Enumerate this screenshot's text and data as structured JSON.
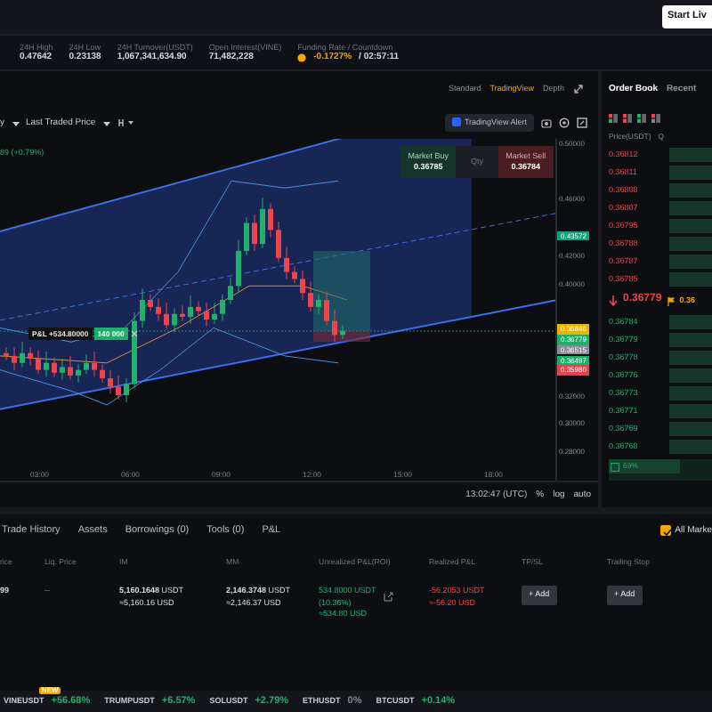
{
  "header": {
    "start_button": "Start Liv"
  },
  "stats": [
    {
      "label": "24H High",
      "value": "0.47642"
    },
    {
      "label": "24H Low",
      "value": "0.23138"
    },
    {
      "label": "24H Turnover(USDT)",
      "value": "1,067,341,634.90"
    },
    {
      "label": "Open Interest(VINE)",
      "value": "71,482,228"
    },
    {
      "label": "Funding Rate / Countdown",
      "kind": "funding",
      "value": "-0.1727%",
      "extra": "/ 02:57:11"
    }
  ],
  "chart_tabs": [
    {
      "label": "Standard",
      "selected": false
    },
    {
      "label": "TradingView",
      "selected": true
    },
    {
      "label": "Depth",
      "selected": false
    }
  ],
  "toolbar": {
    "interval": "y",
    "price_source": "Last Traded Price",
    "alert_button": "TradingView Alert"
  },
  "legend": "89 (+0.79%)",
  "quick_trade": {
    "buy_label": "Market Buy",
    "buy_price": "0.36785",
    "qty": "Qty",
    "sell_label": "Market Sell",
    "sell_price": "0.36784"
  },
  "position_tag": {
    "pnl": "P&L +534.80000",
    "qty": "140 000"
  },
  "price_axis": [
    {
      "text": "0.50000",
      "kind": "tick"
    },
    {
      "text": "0.46000",
      "kind": "tick"
    },
    {
      "text": "0.43572",
      "kind": "tag",
      "color": "#16a07a"
    },
    {
      "text": "0.42000",
      "kind": "tick"
    },
    {
      "text": "0.40000",
      "kind": "tick"
    },
    {
      "text": "0.36846",
      "kind": "tag",
      "color": "#e8b400"
    },
    {
      "text": "0.36779",
      "kind": "tag",
      "color": "#1fae6a"
    },
    {
      "text": "0.36515",
      "kind": "tag",
      "color": "#8a8d95"
    },
    {
      "text": "0.36497",
      "kind": "tag",
      "color": "#1fae6a"
    },
    {
      "text": "0.35980",
      "kind": "tag",
      "color": "#e5414a"
    },
    {
      "text": "0.32000",
      "kind": "tick"
    },
    {
      "text": "0.30000",
      "kind": "tick"
    },
    {
      "text": "0.28000",
      "kind": "tick"
    }
  ],
  "time_axis": [
    "03:00",
    "06:00",
    "09:00",
    "12:00",
    "15:00",
    "18:00"
  ],
  "chart_footer": {
    "time": "13:02:47 (UTC)",
    "options": [
      "%",
      "log",
      "auto"
    ]
  },
  "order_book": {
    "tabs": [
      {
        "label": "Order Book",
        "selected": true
      },
      {
        "label": "Recent",
        "selected": false
      }
    ],
    "columns": [
      "Price(USDT)",
      "Q"
    ],
    "asks": [
      "0.36812",
      "0.36811",
      "0.36808",
      "0.36807",
      "0.36795",
      "0.36788",
      "0.36787",
      "0.36785"
    ],
    "last_price": "0.36779",
    "mark_price": "0.36",
    "bids": [
      "0.36784",
      "0.36779",
      "0.36778",
      "0.36776",
      "0.36773",
      "0.36771",
      "0.36769",
      "0.36768"
    ],
    "bid_ratio": "69%",
    "level": 0.69
  },
  "positions": {
    "tabs": [
      {
        "label": "Trade History",
        "selected": false
      },
      {
        "label": "Assets",
        "selected": false
      },
      {
        "label": "Borrowings (0)",
        "selected": false
      },
      {
        "label": "Tools (0)",
        "selected": false
      },
      {
        "label": "P&L",
        "selected": false
      }
    ],
    "all_markets": {
      "label": "All Marke",
      "checked": true
    },
    "columns": [
      "rice",
      "Liq. Price",
      "IM",
      "MM",
      "Unrealized P&L(ROI)",
      "Realized P&L",
      "TP/SL",
      "Trailing Stop"
    ],
    "rows": [
      {
        "price": "99",
        "liq_price": "--",
        "im": [
          "**5,160.1648** USDT",
          "≈5,160.16 USD"
        ],
        "mm": [
          "**2,146.3748** USDT",
          "≈2,146.37 USD"
        ],
        "unrealized": [
          "534.8000 USDT",
          "(10.36%)",
          "≈534.80 USD"
        ],
        "realized": [
          "-56.2053 USDT",
          "≈-56.20 USD"
        ],
        "tpsl": "+ Add",
        "trailing": "+ Add"
      }
    ]
  },
  "ticker": [
    {
      "symbol": "VINEUSDT",
      "badge": "NEW",
      "change": "+56.68%",
      "color": "#20b26c"
    },
    {
      "symbol": "TRUMPUSDT",
      "change": "+6.57%",
      "color": "#20b26c"
    },
    {
      "symbol": "SOLUSDT",
      "change": "+2.79%",
      "color": "#20b26c"
    },
    {
      "symbol": "ETHUSDT",
      "change": "0%",
      "color": "#80848d"
    },
    {
      "symbol": "BTCUSDT",
      "change": "+0.14%",
      "color": "#20b26c"
    }
  ]
}
